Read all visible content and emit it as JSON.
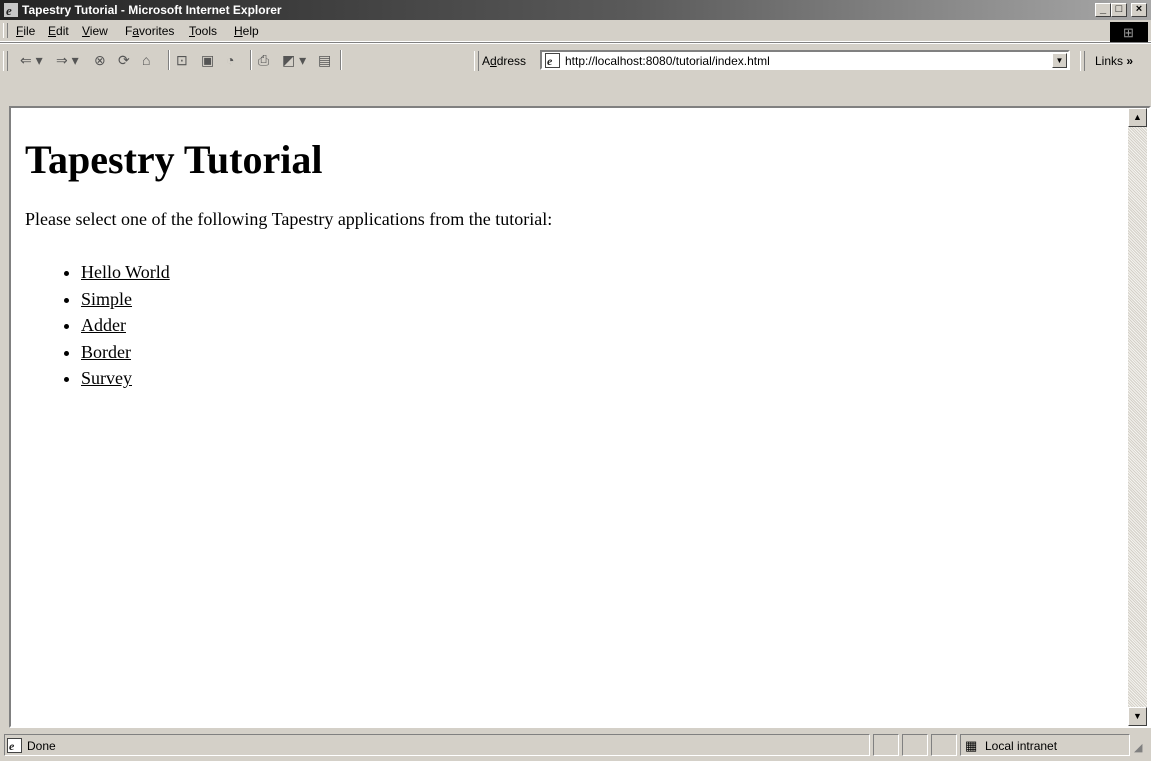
{
  "window": {
    "title": "Tapestry Tutorial - Microsoft Internet Explorer",
    "icon": "ie-icon",
    "minimize": "_",
    "maximize": "□",
    "close": "×"
  },
  "menubar": {
    "items": [
      {
        "label": "File",
        "mnemonic": "F",
        "rest": "ile"
      },
      {
        "label": "Edit",
        "mnemonic": "E",
        "rest": "dit"
      },
      {
        "label": "View",
        "mnemonic": "V",
        "rest": "iew"
      },
      {
        "label": "Favorites",
        "pre": "F",
        "mnemonic": "a",
        "rest": "vorites"
      },
      {
        "label": "Tools",
        "mnemonic": "T",
        "rest": "ools"
      },
      {
        "label": "Help",
        "mnemonic": "H",
        "rest": "elp"
      }
    ]
  },
  "toolbar": {
    "buttons": [
      "back-icon",
      "forward-icon",
      "stop-icon",
      "refresh-icon",
      "home-icon",
      "search-icon",
      "favorites-icon",
      "history-icon",
      "print-icon",
      "edit-icon",
      "discuss-icon"
    ],
    "address_label_pre": "A",
    "address_label_mnemonic": "d",
    "address_label_rest": "dress",
    "url": "http://localhost:8080/tutorial/index.html",
    "links_label": "Links",
    "links_chevron": "»"
  },
  "page": {
    "heading": "Tapestry Tutorial",
    "intro": "Please select one of the following Tapestry applications from the tutorial:",
    "links": [
      "Hello World",
      "Simple",
      "Adder",
      "Border",
      "Survey"
    ]
  },
  "statusbar": {
    "status": "Done",
    "zone": "Local intranet"
  }
}
